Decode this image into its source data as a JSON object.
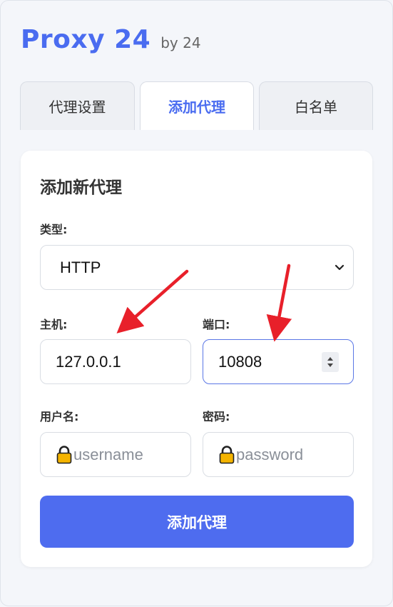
{
  "header": {
    "title": "Proxy 24",
    "byline": "by 24",
    "title_color": "#4a6cf0"
  },
  "tabs": [
    {
      "label": "代理设置",
      "active": false
    },
    {
      "label": "添加代理",
      "active": true
    },
    {
      "label": "白名单",
      "active": false
    }
  ],
  "form": {
    "title": "添加新代理",
    "type_label": "类型:",
    "type_value": "HTTP",
    "host_label": "主机:",
    "host_value": "127.0.0.1",
    "port_label": "端口:",
    "port_value": "10808",
    "username_label": "用户名:",
    "username_placeholder": "username",
    "password_label": "密码:",
    "password_placeholder": "password",
    "submit_label": "添加代理"
  },
  "colors": {
    "accent": "#4e6cef",
    "arrow": "#e8202a"
  },
  "icons": [
    "chevron-down-icon",
    "lock-icon",
    "spinner-arrows-icon"
  ]
}
